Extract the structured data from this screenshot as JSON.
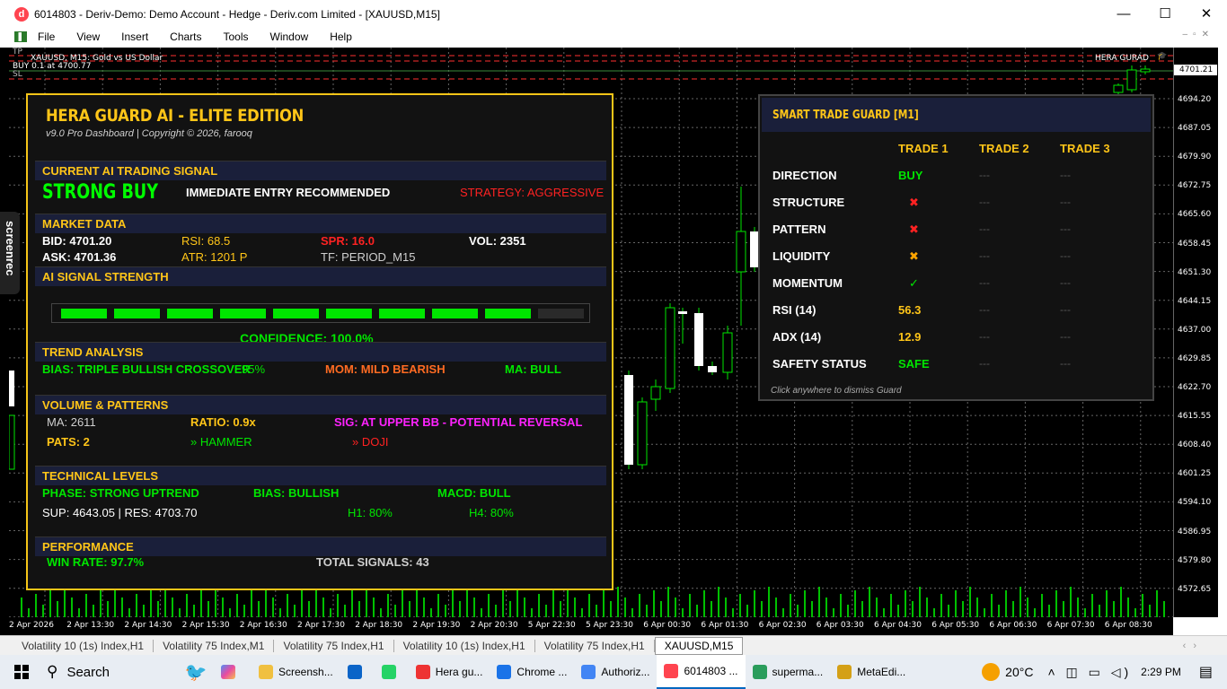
{
  "window": {
    "title": "6014803 - Deriv-Demo: Demo Account - Hedge - Deriv.com Limited - [XAUUSD,M15]",
    "app_icon": "d",
    "minimize": "—",
    "maximize": "☐",
    "close": "✕"
  },
  "menu": [
    "File",
    "View",
    "Insert",
    "Charts",
    "Tools",
    "Window",
    "Help"
  ],
  "chart": {
    "symbol_line": "XAUUSD, M15:  Gold vs US Dollar",
    "tp_label": "TP",
    "buy_line": "BUY 0.1 at 4700.77",
    "sl_label": "SL",
    "ea_name": "HERA GURAD",
    "current_price": "4701.21",
    "price_labels": [
      "4694.20",
      "4687.05",
      "4679.90",
      "4672.75",
      "4665.60",
      "4658.45",
      "4651.30",
      "4644.15",
      "4637.00",
      "4629.85",
      "4622.70",
      "4615.55",
      "4608.40",
      "4601.25",
      "4594.10",
      "4586.95",
      "4579.80",
      "4572.65"
    ],
    "time_labels": [
      "2 Apr 2026",
      "2 Apr 13:30",
      "2 Apr 14:30",
      "2 Apr 15:30",
      "2 Apr 16:30",
      "2 Apr 17:30",
      "2 Apr 18:30",
      "2 Apr 19:30",
      "2 Apr 20:30",
      "5 Apr 22:30",
      "5 Apr 23:30",
      "6 Apr 00:30",
      "6 Apr 01:30",
      "6 Apr 02:30",
      "6 Apr 03:30",
      "6 Apr 04:30",
      "6 Apr 05:30",
      "6 Apr 06:30",
      "6 Apr 07:30",
      "6 Apr 08:30"
    ]
  },
  "dashboard": {
    "title": "HERA GUARD AI - ELITE EDITION",
    "subtitle": "v9.0 Pro Dashboard | Copyright © 2026, farooq",
    "signal": {
      "header": "CURRENT AI TRADING SIGNAL",
      "value": "STRONG BUY",
      "note": "IMMEDIATE ENTRY RECOMMENDED",
      "strategy": "STRATEGY: AGGRESSIVE"
    },
    "market": {
      "header": "MARKET DATA",
      "bid": "BID: 4701.20",
      "rsi": "RSI: 68.5",
      "spr": "SPR: 16.0",
      "vol": "VOL: 2351",
      "ask": "ASK: 4701.36",
      "atr": "ATR: 1201 P",
      "tf": "TF: PERIOD_M15"
    },
    "strength": {
      "header": "AI SIGNAL STRENGTH",
      "segments_on": 9,
      "segments_total": 10,
      "confidence": "CONFIDENCE: 100.0%"
    },
    "trend": {
      "header": "TREND ANALYSIS",
      "bias": "BIAS: TRIPLE BULLISH CROSSOVER",
      "overlay": "95%",
      "mom": "MOM: MILD BEARISH",
      "ma": "MA: BULL"
    },
    "volume": {
      "header": "VOLUME & PATTERNS",
      "ma": "MA: 2611",
      "ratio": "RATIO: 0.9x",
      "sig": "SIG: AT UPPER BB - POTENTIAL REVERSAL",
      "pats": "PATS: 2",
      "p1": "» HAMMER",
      "p2": "» DOJI"
    },
    "levels": {
      "header": "TECHNICAL LEVELS",
      "phase": "PHASE: STRONG UPTREND",
      "bias": "BIAS: BULLISH",
      "macd": "MACD: BULL",
      "supres": "SUP: 4643.05 | RES: 4703.70",
      "h1": "H1: 80%",
      "h4": "H4: 80%"
    },
    "performance": {
      "header": "PERFORMANCE",
      "win": "WIN RATE: 97.7%",
      "total": "TOTAL SIGNALS: 43"
    }
  },
  "guard": {
    "title": "SMART TRADE GUARD [M1]",
    "cols": [
      "TRADE 1",
      "TRADE 2",
      "TRADE 3"
    ],
    "rows": [
      {
        "label": "DIRECTION",
        "v1": "BUY",
        "c1": "#00e600"
      },
      {
        "label": "STRUCTURE",
        "v1": "✖",
        "c1": "#ff2222"
      },
      {
        "label": "PATTERN",
        "v1": "✖",
        "c1": "#ff2222"
      },
      {
        "label": "LIQUIDITY",
        "v1": "✖",
        "c1": "#ffa500"
      },
      {
        "label": "MOMENTUM",
        "v1": "✓",
        "c1": "#00e600"
      },
      {
        "label": "RSI (14)",
        "v1": "56.3",
        "c1": "#ffc518"
      },
      {
        "label": "ADX (14)",
        "v1": "12.9",
        "c1": "#ffc518"
      },
      {
        "label": "SAFETY STATUS",
        "v1": "SAFE",
        "c1": "#00e600"
      }
    ],
    "dash": "---",
    "footer": "Click anywhere to dismiss Guard"
  },
  "tabs": [
    "Volatility 10 (1s) Index,H1",
    "Volatility 75 Index,M1",
    "Volatility 75 Index,H1",
    "Volatility 10 (1s) Index,H1",
    "Volatility 75 Index,H1",
    "XAUUSD,M15"
  ],
  "screenrec": "screenrec",
  "taskbar": {
    "search": "Search",
    "items": [
      {
        "label": "Screensh...",
        "color": "#f0c040"
      },
      {
        "label": "",
        "color": "#0a64c8"
      },
      {
        "label": "",
        "color": "#25d366"
      },
      {
        "label": "Hera gu...",
        "color": "#e33"
      },
      {
        "label": "Chrome ...",
        "color": "#1a73e8"
      },
      {
        "label": "Authoriz...",
        "color": "#4285f4"
      },
      {
        "label": "6014803 ...",
        "color": "#ff444f"
      },
      {
        "label": "superma...",
        "color": "#2a9d5c"
      },
      {
        "label": "MetaEdi...",
        "color": "#d4a017"
      }
    ],
    "weather": "20°C",
    "clock": "2:29 PM"
  }
}
